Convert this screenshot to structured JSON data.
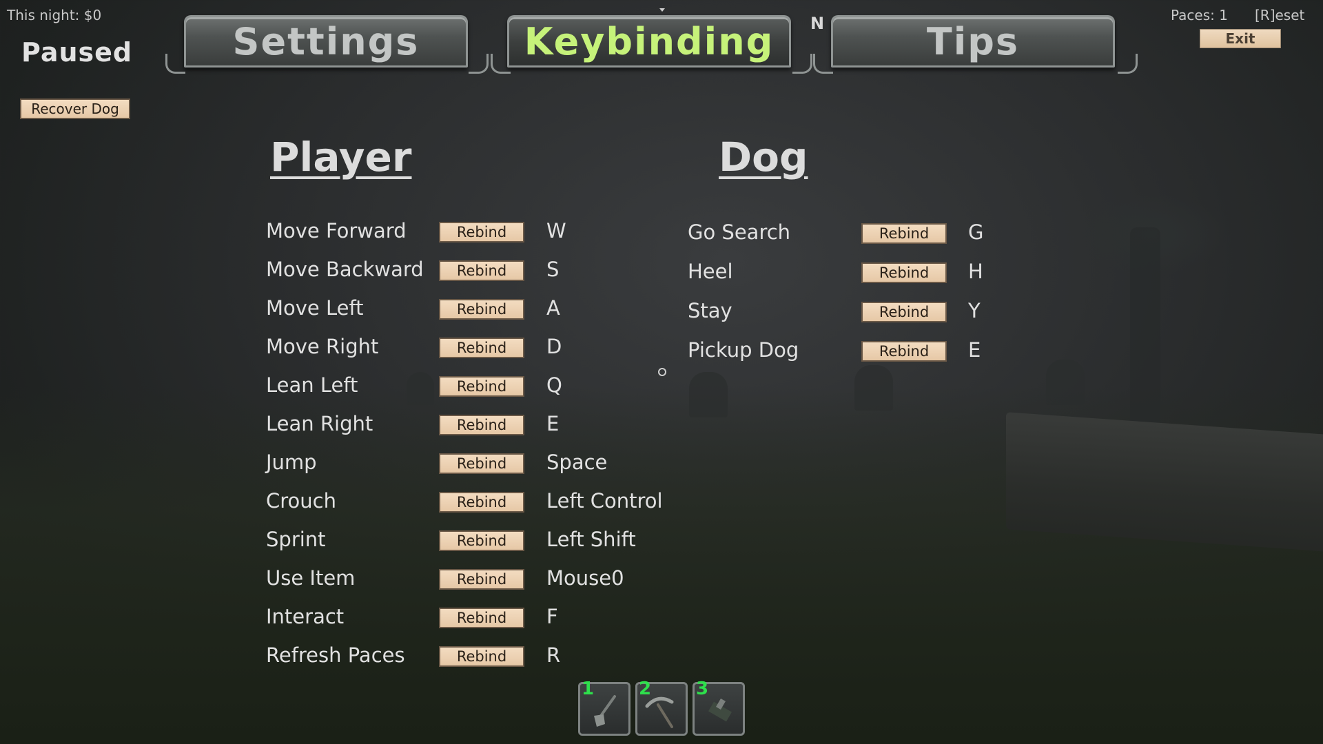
{
  "hud": {
    "night_earnings": "This night: $0",
    "status": "Paused",
    "recover_dog_label": "Recover Dog",
    "paces": "Paces: 1",
    "reset": "[R]eset",
    "exit_label": "Exit",
    "compass": "N"
  },
  "tabs": [
    {
      "label": "Settings",
      "active": false
    },
    {
      "label": "Keybinding",
      "active": true
    },
    {
      "label": "Tips",
      "active": false
    }
  ],
  "player": {
    "title": "Player",
    "rebind_label": "Rebind",
    "bindings": [
      {
        "action": "Move Forward",
        "key": "W"
      },
      {
        "action": "Move Backward",
        "key": "S"
      },
      {
        "action": "Move Left",
        "key": "A"
      },
      {
        "action": "Move Right",
        "key": "D"
      },
      {
        "action": "Lean Left",
        "key": "Q"
      },
      {
        "action": "Lean Right",
        "key": "E"
      },
      {
        "action": "Jump",
        "key": "Space"
      },
      {
        "action": "Crouch",
        "key": "Left Control"
      },
      {
        "action": "Sprint",
        "key": "Left Shift"
      },
      {
        "action": "Use Item",
        "key": "Mouse0"
      },
      {
        "action": "Interact",
        "key": "F"
      },
      {
        "action": "Refresh Paces",
        "key": "R"
      }
    ]
  },
  "dog": {
    "title": "Dog",
    "rebind_label": "Rebind",
    "bindings": [
      {
        "action": "Go Search",
        "key": "G"
      },
      {
        "action": "Heel",
        "key": "H"
      },
      {
        "action": "Stay",
        "key": "Y"
      },
      {
        "action": "Pickup Dog",
        "key": "E"
      }
    ]
  },
  "hotbar": [
    {
      "slot": "1",
      "icon": "shovel-icon"
    },
    {
      "slot": "2",
      "icon": "pickaxe-icon"
    },
    {
      "slot": "3",
      "icon": "tool-icon"
    }
  ],
  "colors": {
    "active_tab": "#c6f27a",
    "button_tan": "#e6c8a6",
    "slot_number": "#2ee04c"
  }
}
